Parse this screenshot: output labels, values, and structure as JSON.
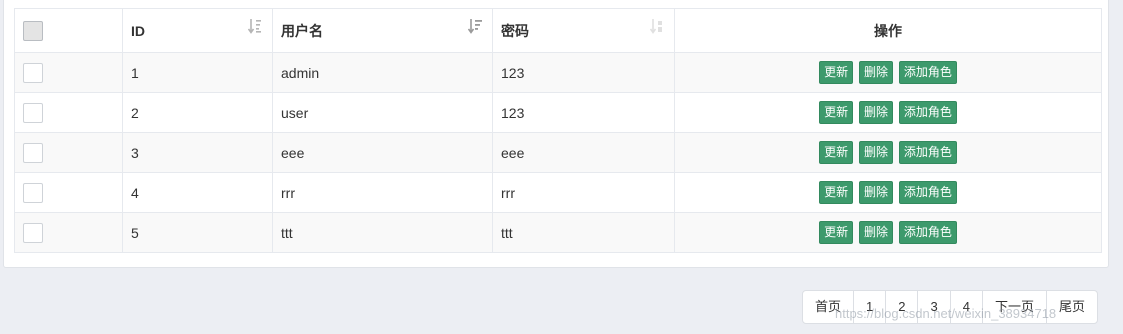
{
  "table": {
    "columns": [
      {
        "key": "select",
        "label": ""
      },
      {
        "key": "id",
        "label": "ID"
      },
      {
        "key": "username",
        "label": "用户名"
      },
      {
        "key": "password",
        "label": "密码"
      },
      {
        "key": "ops",
        "label": "操作"
      }
    ],
    "actions": {
      "update": "更新",
      "delete": "删除",
      "add_role": "添加角色"
    },
    "rows": [
      {
        "id": "1",
        "username": "admin",
        "password": "123"
      },
      {
        "id": "2",
        "username": "user",
        "password": "123"
      },
      {
        "id": "3",
        "username": "eee",
        "password": "eee"
      },
      {
        "id": "4",
        "username": "rrr",
        "password": "rrr"
      },
      {
        "id": "5",
        "username": "ttt",
        "password": "ttt"
      }
    ]
  },
  "pagination": {
    "first": "首页",
    "pages": [
      "1",
      "2",
      "3",
      "4"
    ],
    "next": "下一页",
    "last": "尾页"
  },
  "watermark": "https://blog.csdn.net/weixin_38934718",
  "colors": {
    "action_button": "#3d9a6c",
    "page_background": "#eceef3"
  }
}
